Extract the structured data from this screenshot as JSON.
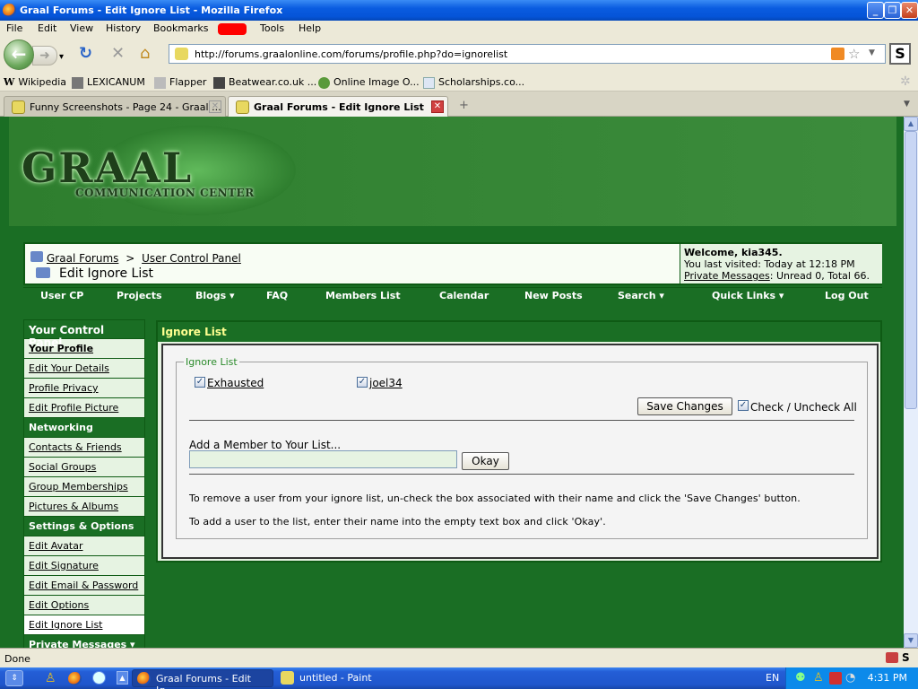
{
  "window": {
    "title": "Graal Forums - Edit Ignore List - Mozilla Firefox"
  },
  "menu": {
    "file": "File",
    "edit": "Edit",
    "view": "View",
    "history": "History",
    "bookmarks": "Bookmarks",
    "tools": "Tools",
    "help": "Help"
  },
  "nav": {
    "url": "http://forums.graalonline.com/forums/profile.php?do=ignorelist"
  },
  "bookmarks": [
    "Wikipedia",
    "LEXICANUM",
    "Flapper",
    "Beatwear.co.uk ...",
    "Online Image O...",
    "Scholarships.co..."
  ],
  "tabs": [
    {
      "label": "Funny Screenshots - Page 24 - Graal ..."
    },
    {
      "label": "Graal Forums - Edit Ignore List"
    }
  ],
  "header": {
    "logo": "GRAAL",
    "logo_sub": "COMMUNICATION CENTER"
  },
  "breadcrumb": {
    "root": "Graal Forums",
    "sep": ">",
    "parent": "User Control Panel",
    "current": "Edit Ignore List"
  },
  "welcome": {
    "greeting": "Welcome, kia345.",
    "last_visit": "You last visited: Today at 12:18 PM",
    "pm_link": "Private Messages",
    "pm_text": ": Unread 0, Total 66."
  },
  "navstrip": [
    "User CP",
    "Projects",
    "Blogs ▾",
    "FAQ",
    "Members List",
    "Calendar",
    "New Posts",
    "Search ▾",
    "Quick Links ▾",
    "Log Out"
  ],
  "sidebar": {
    "title": "Your Control Panel",
    "items": [
      "Your Profile",
      "Edit Your Details",
      "Profile Privacy",
      "Edit Profile Picture",
      "Networking",
      "Contacts & Friends",
      "Social Groups",
      "Group Memberships",
      "Pictures & Albums",
      "Settings & Options",
      "Edit Avatar",
      "Edit Signature",
      "Edit Email & Password",
      "Edit Options",
      "Edit Ignore List",
      "Private Messages ▾"
    ]
  },
  "panel": {
    "title": "Ignore List",
    "legend": "Ignore List",
    "users": [
      "Exhausted",
      "joel34"
    ],
    "save_label": "Save Changes",
    "check_all_label": "Check / Uncheck All",
    "add_label": "Add a Member to Your List...",
    "add_value": "",
    "okay_label": "Okay",
    "help1": "To remove a user from your ignore list, un-check the box associated with their name and click the 'Save Changes' button.",
    "help2": "To add a user to the list, enter their name into the empty text box and click 'Okay'."
  },
  "status": {
    "text": "Done"
  },
  "taskbar": {
    "items": [
      "Graal Forums - Edit Ig...",
      "untitled - Paint"
    ],
    "lang": "EN",
    "clock": "4:31 PM"
  }
}
